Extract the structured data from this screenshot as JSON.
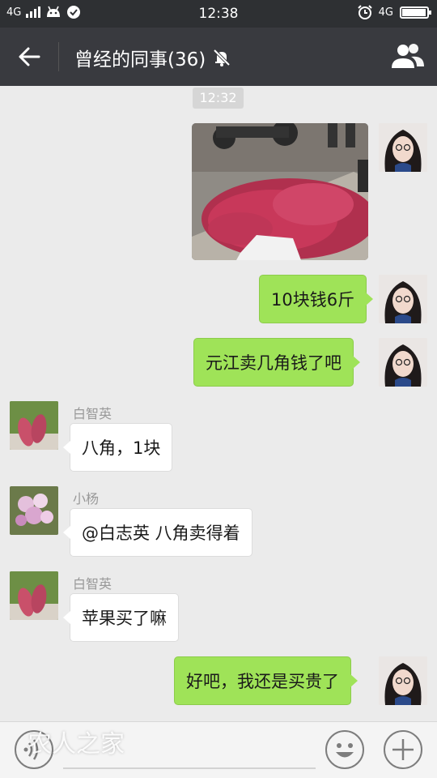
{
  "status_bar": {
    "network_left": "4G",
    "time": "12:38",
    "network_right": "4G",
    "battery_level": 0.95,
    "icons": [
      "signal-icon",
      "android-icon",
      "check-circle-icon",
      "alarm-icon",
      "battery-icon"
    ]
  },
  "header": {
    "title": "曾经的同事(36)",
    "icons": [
      "back-arrow-icon",
      "mute-bell-icon",
      "group-members-icon"
    ]
  },
  "chat": {
    "timestamp": "12:32",
    "messages": [
      {
        "from": "self",
        "type": "image"
      },
      {
        "from": "self",
        "text": "10块钱6斤"
      },
      {
        "from": "self",
        "text": "元江卖几角钱了吧"
      },
      {
        "from": "other",
        "sender": "白智英",
        "text": "八角，1块"
      },
      {
        "from": "other",
        "sender": "小杨",
        "text": "@白志英 八角卖得着"
      },
      {
        "from": "other",
        "sender": "白智英",
        "text": "苹果买了嘛"
      },
      {
        "from": "self",
        "text": "好吧，我还是买贵了"
      }
    ]
  },
  "input_bar": {
    "watermark": "农人之家",
    "icons": [
      "voice-icon",
      "emoji-icon",
      "plus-icon"
    ]
  },
  "colors": {
    "status_bar_bg": "#2e3033",
    "title_bar_bg": "#393a3f",
    "chat_bg": "#ebebeb",
    "self_bubble": "#9fe358",
    "other_bubble": "#ffffff"
  }
}
